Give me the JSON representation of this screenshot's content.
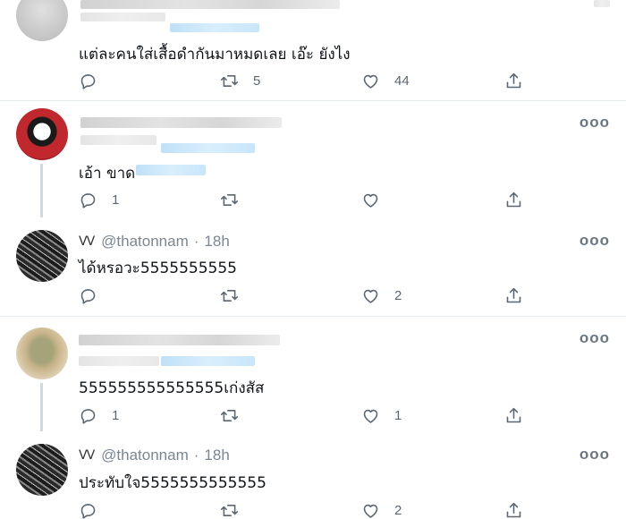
{
  "tweets": [
    {
      "id": "t1",
      "header_visible": false,
      "text": "แต่ละคนใส่เสื้อดำกันมาหมดเลย เอ๊ะ ยังไง",
      "replies": "",
      "retweets": "5",
      "likes": "44"
    },
    {
      "id": "t2",
      "text": "เอ้า ขาด",
      "replies": "1",
      "retweets": "",
      "likes": ""
    },
    {
      "id": "t3",
      "signature": "ᐯᐯ",
      "handle": "@thatonnam",
      "dot": "·",
      "time": "18h",
      "text": "ได้หรอวะ5555555555",
      "replies": "",
      "retweets": "",
      "likes": "2"
    },
    {
      "id": "t4",
      "text": "555555555555555เก่งสัส",
      "replies": "1",
      "retweets": "",
      "likes": "1"
    },
    {
      "id": "t5",
      "signature": "ᐯᐯ",
      "handle": "@thatonnam",
      "dot": "·",
      "time": "18h",
      "text": "ประทับใจ5555555555555",
      "replies": "",
      "retweets": "",
      "likes": "2"
    }
  ],
  "more_label": "ooo",
  "icons": [
    "reply-icon",
    "retweet-icon",
    "like-icon",
    "share-icon",
    "more-icon"
  ],
  "colors": {
    "muted": "#5b6770",
    "divider": "#e6ecf0",
    "blur_blue": "#c8e6fa"
  }
}
